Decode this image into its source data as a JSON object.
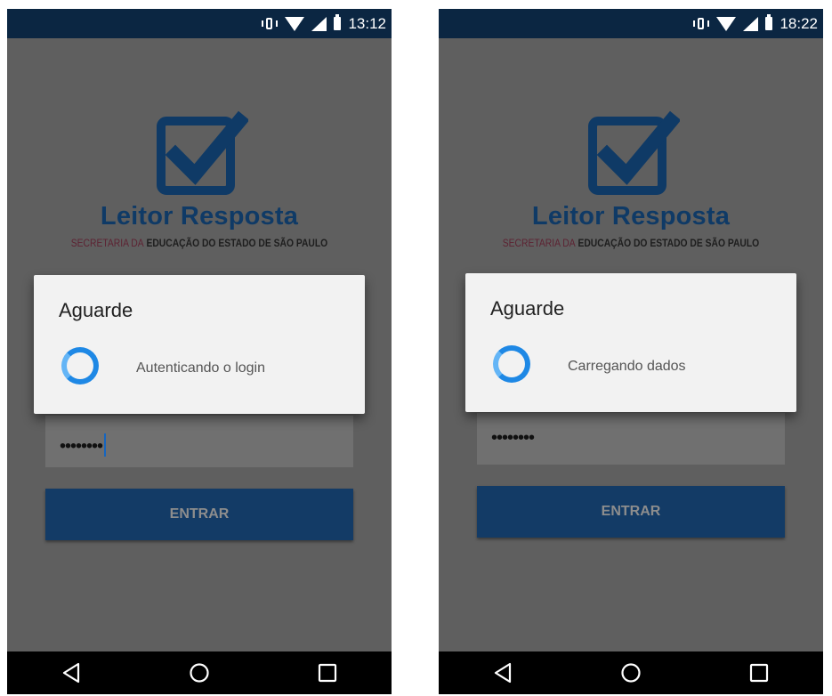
{
  "screens": [
    {
      "status_time": "13:12",
      "app_title": "Leitor Resposta",
      "subtitle_light": "SECRETARIA DA",
      "subtitle_dark": "EDUCAÇÃO DO ESTADO DE SÃO PAULO",
      "password_value": "••••••••",
      "login_button_label": "ENTRAR",
      "dialog_title": "Aguarde",
      "dialog_message": "Autenticando o login"
    },
    {
      "status_time": "18:22",
      "app_title": "Leitor Resposta",
      "subtitle_light": "SECRETARIA DA",
      "subtitle_dark": "EDUCAÇÃO DO ESTADO DE SÃO PAULO",
      "password_value": "••••••••",
      "login_button_label": "ENTRAR",
      "dialog_title": "Aguarde",
      "dialog_message": "Carregando dados"
    }
  ],
  "icons": {
    "status": [
      "vibrate-icon",
      "wifi-icon",
      "signal-icon",
      "battery-icon"
    ],
    "logo": "checkbox-check-icon",
    "nav": [
      "back-icon",
      "home-icon",
      "recents-icon"
    ]
  },
  "colors": {
    "status_bar": "#0b2642",
    "background_dimmed": "#5f5f5f",
    "brand_blue": "#0f3a66",
    "button": "#133b66",
    "spinner": "#1e88e5",
    "dialog": "#f2f2f2"
  }
}
